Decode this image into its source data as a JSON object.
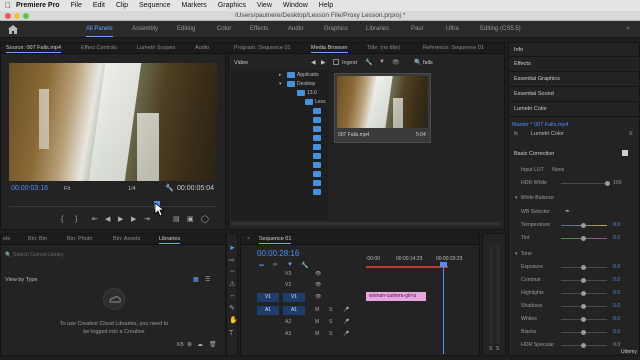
{
  "menubar": {
    "apple": "",
    "items": [
      "Premiere Pro",
      "File",
      "Edit",
      "Clip",
      "Sequence",
      "Markers",
      "Graphics",
      "View",
      "Window",
      "Help"
    ]
  },
  "titlebar": {
    "title": "/Users/paulnere/Desktop/Lesson File/Proxy Lesson.prproj *"
  },
  "workspaces": {
    "items": [
      "All Panels",
      "Assembly",
      "Editing",
      "Color",
      "Effects",
      "Audio",
      "Graphics",
      "Libraries",
      "Paul",
      "Ultra",
      "Editing (CS5.5)"
    ],
    "active": "All Panels",
    "more": "»"
  },
  "source": {
    "tabs": [
      "Source: 007 Falls.mp4",
      "Effect Controls",
      "Lumetri Scopes",
      "Audio"
    ],
    "timecode_in": "00:00:03:16",
    "fit": "Fit",
    "ratio": "1/4",
    "timecode_out": "00:00:05:04"
  },
  "program": {
    "tabs": [
      "Program: Sequence 01",
      "Media Browser",
      "Title: (no title)",
      "Reference: Sequence 01"
    ]
  },
  "media_browser": {
    "dropdown": "Video",
    "ingest_label": "Ingest",
    "search_value": "falls",
    "tree": [
      "Applicatio",
      "Desktop",
      "13.0",
      "Less",
      "",
      "",
      "",
      "",
      "",
      "",
      ""
    ],
    "thumb_name": "007 Falls.mp4",
    "thumb_duration": "5:04"
  },
  "bins": {
    "tabs": [
      "els",
      "Bin: Bin",
      "Bin: Photo",
      "Bin: Assets",
      "Libraries"
    ],
    "search_placeholder": "Search Current Library",
    "view_by": "View by Type",
    "message": "To use Creative Cloud Libraries, you need to be logged into a Creative",
    "kb": "KB"
  },
  "timeline": {
    "tab": "Sequence 01",
    "timecode": "00:00:28:16",
    "ruler": [
      ":00:00",
      "00:00:14:23",
      "00:00:29:23"
    ],
    "tracks": [
      "V3",
      "V2",
      "V1",
      "A1",
      "A2",
      "A3"
    ],
    "track_letters": [
      "M",
      "S",
      "M",
      "S",
      "M",
      "S"
    ],
    "src_tracks": [
      "V1",
      "A1"
    ],
    "clip": "woman-camera-girl-p"
  },
  "meters": {
    "labels": [
      "S",
      "S"
    ]
  },
  "right_panel": {
    "items": [
      "Info",
      "Effects",
      "Essential Graphics",
      "Essential Sound",
      "Lumetri Color"
    ],
    "master": "Master * 007 Falls.mp4",
    "lumetri_dropdown": "Lumetri Color",
    "basic_correction": "Basic Correction",
    "input_lut": "Input LUT",
    "input_lut_value": "None",
    "hdr_white": "HDR White",
    "hdr_value": "100",
    "white_balance": "White Balance",
    "wb_selector": "WB Selector",
    "temperature": "Temperature",
    "tint": "Tint",
    "tone": "Tone",
    "tone_items": [
      "Exposure",
      "Contrast",
      "Highlights",
      "Shadows",
      "Whites",
      "Blacks",
      "HDR Specular"
    ],
    "zero": "0.0",
    "udemy": "Udemy"
  },
  "colors": {
    "accent": "#4f8ef7",
    "playhead": "#4f8ef7",
    "clip": "#e7a6e0",
    "track_hdr": "#1e3d6b"
  }
}
